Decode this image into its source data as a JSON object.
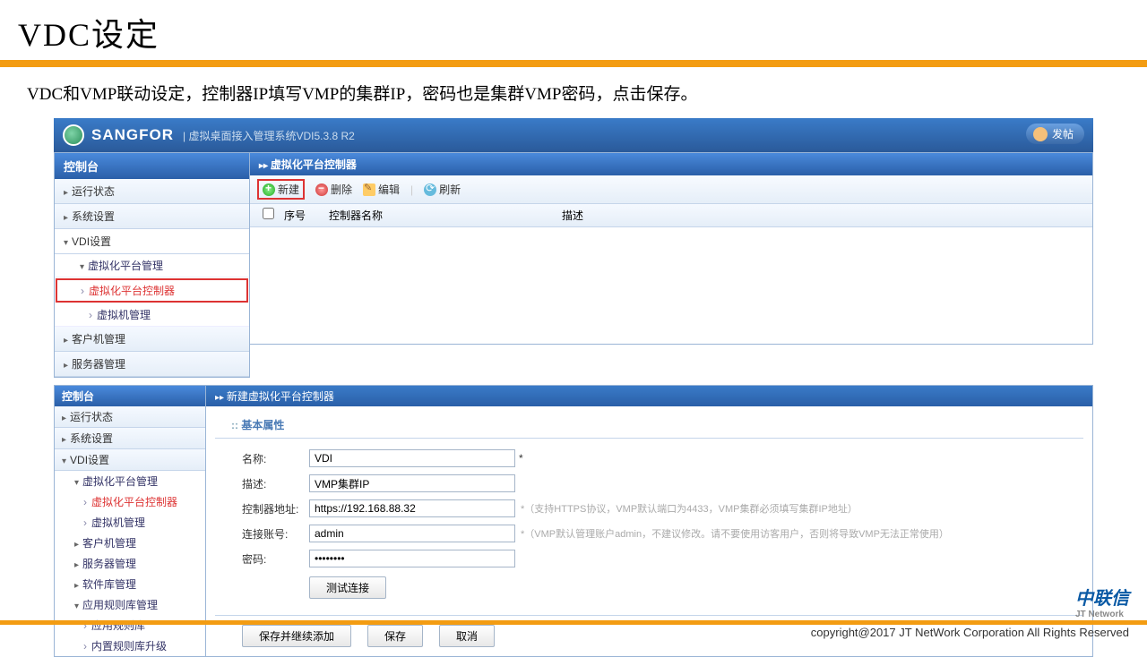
{
  "slide": {
    "title": "VDC设定",
    "desc": "VDC和VMP联动设定，控制器IP填写VMP的集群IP，密码也是集群VMP密码，点击保存。"
  },
  "topbar": {
    "brand": "SANGFOR",
    "subtitle": "| 虚拟桌面接入管理系统VDI5.3.8 R2",
    "post": "发帖"
  },
  "sidebar1": {
    "header": "控制台",
    "items": [
      "运行状态",
      "系统设置",
      "VDI设置"
    ],
    "vdi_children": {
      "vplatform": "虚拟化平台管理",
      "controller": "虚拟化平台控制器",
      "vm": "虚拟机管理"
    },
    "rest": [
      "客户机管理",
      "服务器管理"
    ]
  },
  "content1": {
    "header": "虚拟化平台控制器",
    "toolbar": {
      "add": "新建",
      "del": "删除",
      "edit": "编辑",
      "refresh": "刷新"
    },
    "columns": {
      "sn": "序号",
      "name": "控制器名称",
      "desc": "描述"
    }
  },
  "sidebar2": {
    "header": "控制台",
    "items": [
      "运行状态",
      "系统设置",
      "VDI设置"
    ],
    "vdi_children": {
      "vplatform": "虚拟化平台管理",
      "controller": "虚拟化平台控制器",
      "vm": "虚拟机管理"
    },
    "rest": [
      "客户机管理",
      "服务器管理",
      "软件库管理"
    ],
    "rulelib": {
      "parent": "应用规则库管理",
      "children": [
        "应用规则库",
        "内置规则库升级"
      ]
    }
  },
  "content2": {
    "header": "新建虚拟化平台控制器",
    "section": "基本属性",
    "labels": {
      "name": "名称:",
      "desc": "描述:",
      "addr": "控制器地址:",
      "acct": "连接账号:",
      "pwd": "密码:"
    },
    "values": {
      "name": "VDI",
      "desc": "VMP集群IP",
      "addr": "https://192.168.88.32",
      "acct": "admin",
      "pwd": "••••••••"
    },
    "hints": {
      "addr": "*（支持HTTPS协议，VMP默认端口为4433，VMP集群必须填写集群IP地址）",
      "acct": "*（VMP默认管理账户admin，不建议修改。请不要使用访客用户，否则将导致VMP无法正常使用）"
    },
    "buttons": {
      "test": "测试连接",
      "save_cont": "保存并继续添加",
      "save": "保存",
      "cancel": "取消"
    }
  },
  "footer": {
    "logo": "中联信",
    "logo_sub": "JT Network",
    "copyright": "copyright@2017  JT NetWork Corporation All Rights Reserved"
  }
}
